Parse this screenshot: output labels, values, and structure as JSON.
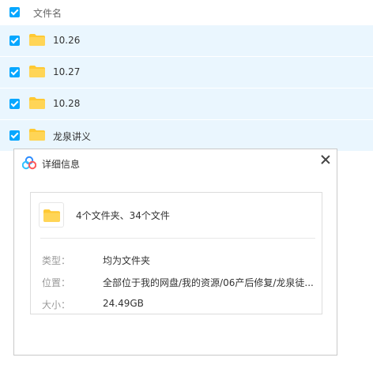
{
  "list": {
    "header_label": "文件名",
    "rows": [
      {
        "name": "10.26",
        "checked": true
      },
      {
        "name": "10.27",
        "checked": true
      },
      {
        "name": "10.28",
        "checked": true
      },
      {
        "name": "龙泉讲义",
        "checked": true
      }
    ]
  },
  "dialog": {
    "title": "详细信息",
    "summary": "4个文件夹、34个文件",
    "fields": [
      {
        "label": "类型：",
        "value": "均为文件夹"
      },
      {
        "label": "位置：",
        "value": "全部位于我的网盘/我的资源/06产后修复/龙泉徒..."
      },
      {
        "label": "大小：",
        "value": "24.49GB"
      }
    ]
  },
  "colors": {
    "accent": "#06a7ff",
    "row_selected_bg": "#eaf6fe",
    "folder_yellow": "#ffc933"
  },
  "icons": {
    "checkbox": "checkbox-checked-icon",
    "folder": "folder-icon",
    "app": "baidu-netdisk-logo-icon",
    "close": "close-icon"
  }
}
